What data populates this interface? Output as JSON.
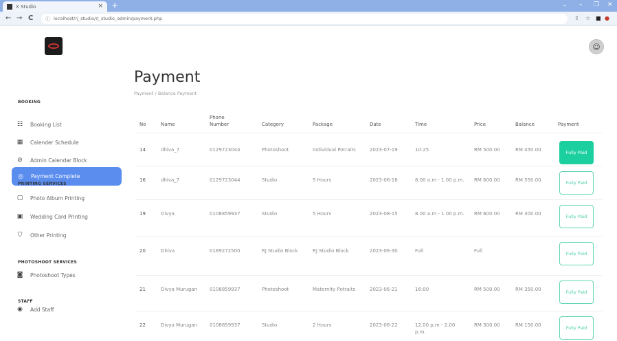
{
  "browser": {
    "tab_title": "X Studio",
    "tab_close": "×",
    "new_tab": "+",
    "url": "localhost/rj_studio/rj_studio_admin/payment.php",
    "back": "←",
    "forward": "→",
    "reload": "C"
  },
  "sidebar": {
    "sections": [
      {
        "title": "BOOKING",
        "items": [
          {
            "icon": "list-icon",
            "glyph": "☷",
            "label": "Booking List"
          },
          {
            "icon": "calendar-icon",
            "glyph": "▦",
            "label": "Calender Schedule"
          },
          {
            "icon": "block-icon",
            "glyph": "⊘",
            "label": "Admin Calendar Block"
          },
          {
            "icon": "payment-icon",
            "glyph": "◎",
            "label": "Payment Complete",
            "active": true
          }
        ]
      },
      {
        "title": "PRINTING SERVICES",
        "items": [
          {
            "icon": "album-icon",
            "glyph": "▢",
            "label": "Photo Album Printing"
          },
          {
            "icon": "card-icon",
            "glyph": "▣",
            "label": "Wedding Card Printing"
          },
          {
            "icon": "printer-icon",
            "glyph": "⛉",
            "label": "Other Printing"
          }
        ]
      },
      {
        "title": "PHOTOSHOOT SERVICES",
        "items": [
          {
            "icon": "camera-icon",
            "glyph": "◙",
            "label": "Photoshoot Types"
          }
        ]
      },
      {
        "title": "STAFF",
        "items": [
          {
            "icon": "user-icon",
            "glyph": "◉",
            "label": "Add Staff"
          }
        ]
      }
    ]
  },
  "header": {
    "avatar_glyph": "☺"
  },
  "page": {
    "title": "Payment",
    "breadcrumb": [
      "Payment",
      "/",
      "Balance Payment"
    ]
  },
  "table": {
    "headers": [
      "No",
      "Name",
      "Phone Number",
      "Category",
      "Package",
      "Date",
      "Time",
      "Price",
      "Balance",
      "Payment"
    ],
    "rows": [
      {
        "no": "14",
        "name": "dhiva_7",
        "phone": "0129723044",
        "category": "Photoshoot",
        "package": "Individual Potraits",
        "date": "2023-07-19",
        "time": "10:25",
        "price": "RM 500.00",
        "balance": "RM 450.00",
        "payment": "Fully Paid",
        "style": "solid"
      },
      {
        "no": "16",
        "name": "dhiva_7",
        "phone": "0129723044",
        "category": "Studio",
        "package": "5 Hours",
        "date": "2023-06-16",
        "time": "8.00 a.m - 1.00 p.m.",
        "price": "RM 600.00",
        "balance": "RM 550.00",
        "payment": "Fully Paid",
        "style": "outline"
      },
      {
        "no": "19",
        "name": "Divya",
        "phone": "0108859937",
        "category": "Studio",
        "package": "5 Hours",
        "date": "2023-08-15",
        "time": "8.00 a.m - 1.00 p.m.",
        "price": "RM 600.00",
        "balance": "RM 300.00",
        "payment": "Fully Paid",
        "style": "outline"
      },
      {
        "no": "20",
        "name": "Dhiva",
        "phone": "0189272500",
        "category": "RJ Studio Block",
        "package": "RJ Studio Block",
        "date": "2023-06-30",
        "time": "Full",
        "price": "Full",
        "balance": "",
        "payment": "Fully Paid",
        "style": "outline"
      },
      {
        "no": "21",
        "name": "Divya Murugan",
        "phone": "0108859937",
        "category": "Photoshoot",
        "package": "Maternity Potraits",
        "date": "2023-06-21",
        "time": "16:00",
        "price": "RM 500.00",
        "balance": "RM 350.00",
        "payment": "Fully Paid",
        "style": "outline"
      },
      {
        "no": "22",
        "name": "Divya Murugan",
        "phone": "0108859937",
        "category": "Studio",
        "package": "2 Hours",
        "date": "2023-06-22",
        "time": "12.00 p.m - 2.00 p.m.",
        "price": "RM 300.00",
        "balance": "RM 150.00",
        "payment": "Fully Paid",
        "style": "outline"
      }
    ]
  },
  "colors": {
    "accent": "#5b8def",
    "paid_solid": "#1ccf9f",
    "paid_outline": "#4fcfae"
  }
}
